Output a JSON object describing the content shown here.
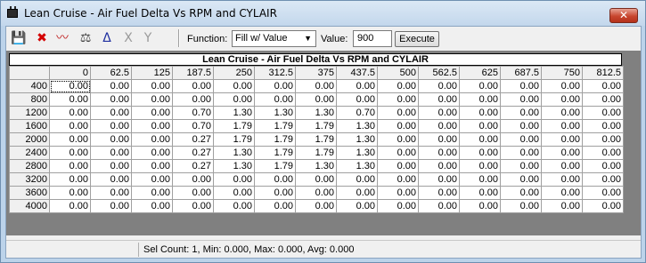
{
  "window": {
    "title": "Lean Cruise - Air Fuel Delta Vs RPM and CYLAIR",
    "close_glyph": "✕"
  },
  "toolbar": {
    "icons": [
      {
        "name": "save-icon",
        "glyph": "💾",
        "color": "#1b3a8c"
      },
      {
        "name": "delete-icon",
        "glyph": "✖",
        "color": "#d40000"
      },
      {
        "name": "graph-icon",
        "glyph": "〰",
        "color": "#c02020"
      },
      {
        "name": "balance-icon",
        "glyph": "⚖",
        "color": "#404040"
      },
      {
        "name": "delta-icon",
        "glyph": "Δ",
        "color": "#2030a0"
      },
      {
        "name": "x-axis-icon",
        "glyph": "X",
        "color": "#9a9a9a"
      },
      {
        "name": "y-axis-icon",
        "glyph": "Y",
        "color": "#9a9a9a"
      }
    ],
    "function_label": "Function:",
    "function_value": "Fill w/ Value",
    "value_label": "Value:",
    "value_input": "900",
    "execute_label": "Execute"
  },
  "table": {
    "title": "Lean Cruise - Air Fuel Delta Vs RPM and CYLAIR",
    "columns": [
      "0",
      "62.5",
      "125",
      "187.5",
      "250",
      "312.5",
      "375",
      "437.5",
      "500",
      "562.5",
      "625",
      "687.5",
      "750",
      "812.5"
    ],
    "rows": [
      {
        "label": "400",
        "values": [
          "0.00",
          "0.00",
          "0.00",
          "0.00",
          "0.00",
          "0.00",
          "0.00",
          "0.00",
          "0.00",
          "0.00",
          "0.00",
          "0.00",
          "0.00",
          "0.00"
        ]
      },
      {
        "label": "800",
        "values": [
          "0.00",
          "0.00",
          "0.00",
          "0.00",
          "0.00",
          "0.00",
          "0.00",
          "0.00",
          "0.00",
          "0.00",
          "0.00",
          "0.00",
          "0.00",
          "0.00"
        ]
      },
      {
        "label": "1200",
        "values": [
          "0.00",
          "0.00",
          "0.00",
          "0.70",
          "1.30",
          "1.30",
          "1.30",
          "0.70",
          "0.00",
          "0.00",
          "0.00",
          "0.00",
          "0.00",
          "0.00"
        ]
      },
      {
        "label": "1600",
        "values": [
          "0.00",
          "0.00",
          "0.00",
          "0.70",
          "1.79",
          "1.79",
          "1.79",
          "1.30",
          "0.00",
          "0.00",
          "0.00",
          "0.00",
          "0.00",
          "0.00"
        ]
      },
      {
        "label": "2000",
        "values": [
          "0.00",
          "0.00",
          "0.00",
          "0.27",
          "1.79",
          "1.79",
          "1.79",
          "1.30",
          "0.00",
          "0.00",
          "0.00",
          "0.00",
          "0.00",
          "0.00"
        ]
      },
      {
        "label": "2400",
        "values": [
          "0.00",
          "0.00",
          "0.00",
          "0.27",
          "1.30",
          "1.79",
          "1.79",
          "1.30",
          "0.00",
          "0.00",
          "0.00",
          "0.00",
          "0.00",
          "0.00"
        ]
      },
      {
        "label": "2800",
        "values": [
          "0.00",
          "0.00",
          "0.00",
          "0.27",
          "1.30",
          "1.79",
          "1.30",
          "1.30",
          "0.00",
          "0.00",
          "0.00",
          "0.00",
          "0.00",
          "0.00"
        ]
      },
      {
        "label": "3200",
        "values": [
          "0.00",
          "0.00",
          "0.00",
          "0.00",
          "0.00",
          "0.00",
          "0.00",
          "0.00",
          "0.00",
          "0.00",
          "0.00",
          "0.00",
          "0.00",
          "0.00"
        ]
      },
      {
        "label": "3600",
        "values": [
          "0.00",
          "0.00",
          "0.00",
          "0.00",
          "0.00",
          "0.00",
          "0.00",
          "0.00",
          "0.00",
          "0.00",
          "0.00",
          "0.00",
          "0.00",
          "0.00"
        ]
      },
      {
        "label": "4000",
        "values": [
          "0.00",
          "0.00",
          "0.00",
          "0.00",
          "0.00",
          "0.00",
          "0.00",
          "0.00",
          "0.00",
          "0.00",
          "0.00",
          "0.00",
          "0.00",
          "0.00"
        ]
      }
    ],
    "selected_row": 0,
    "selected_col": 0
  },
  "status": {
    "text": "Sel Count: 1, Min: 0.000, Max: 0.000, Avg: 0.000"
  }
}
